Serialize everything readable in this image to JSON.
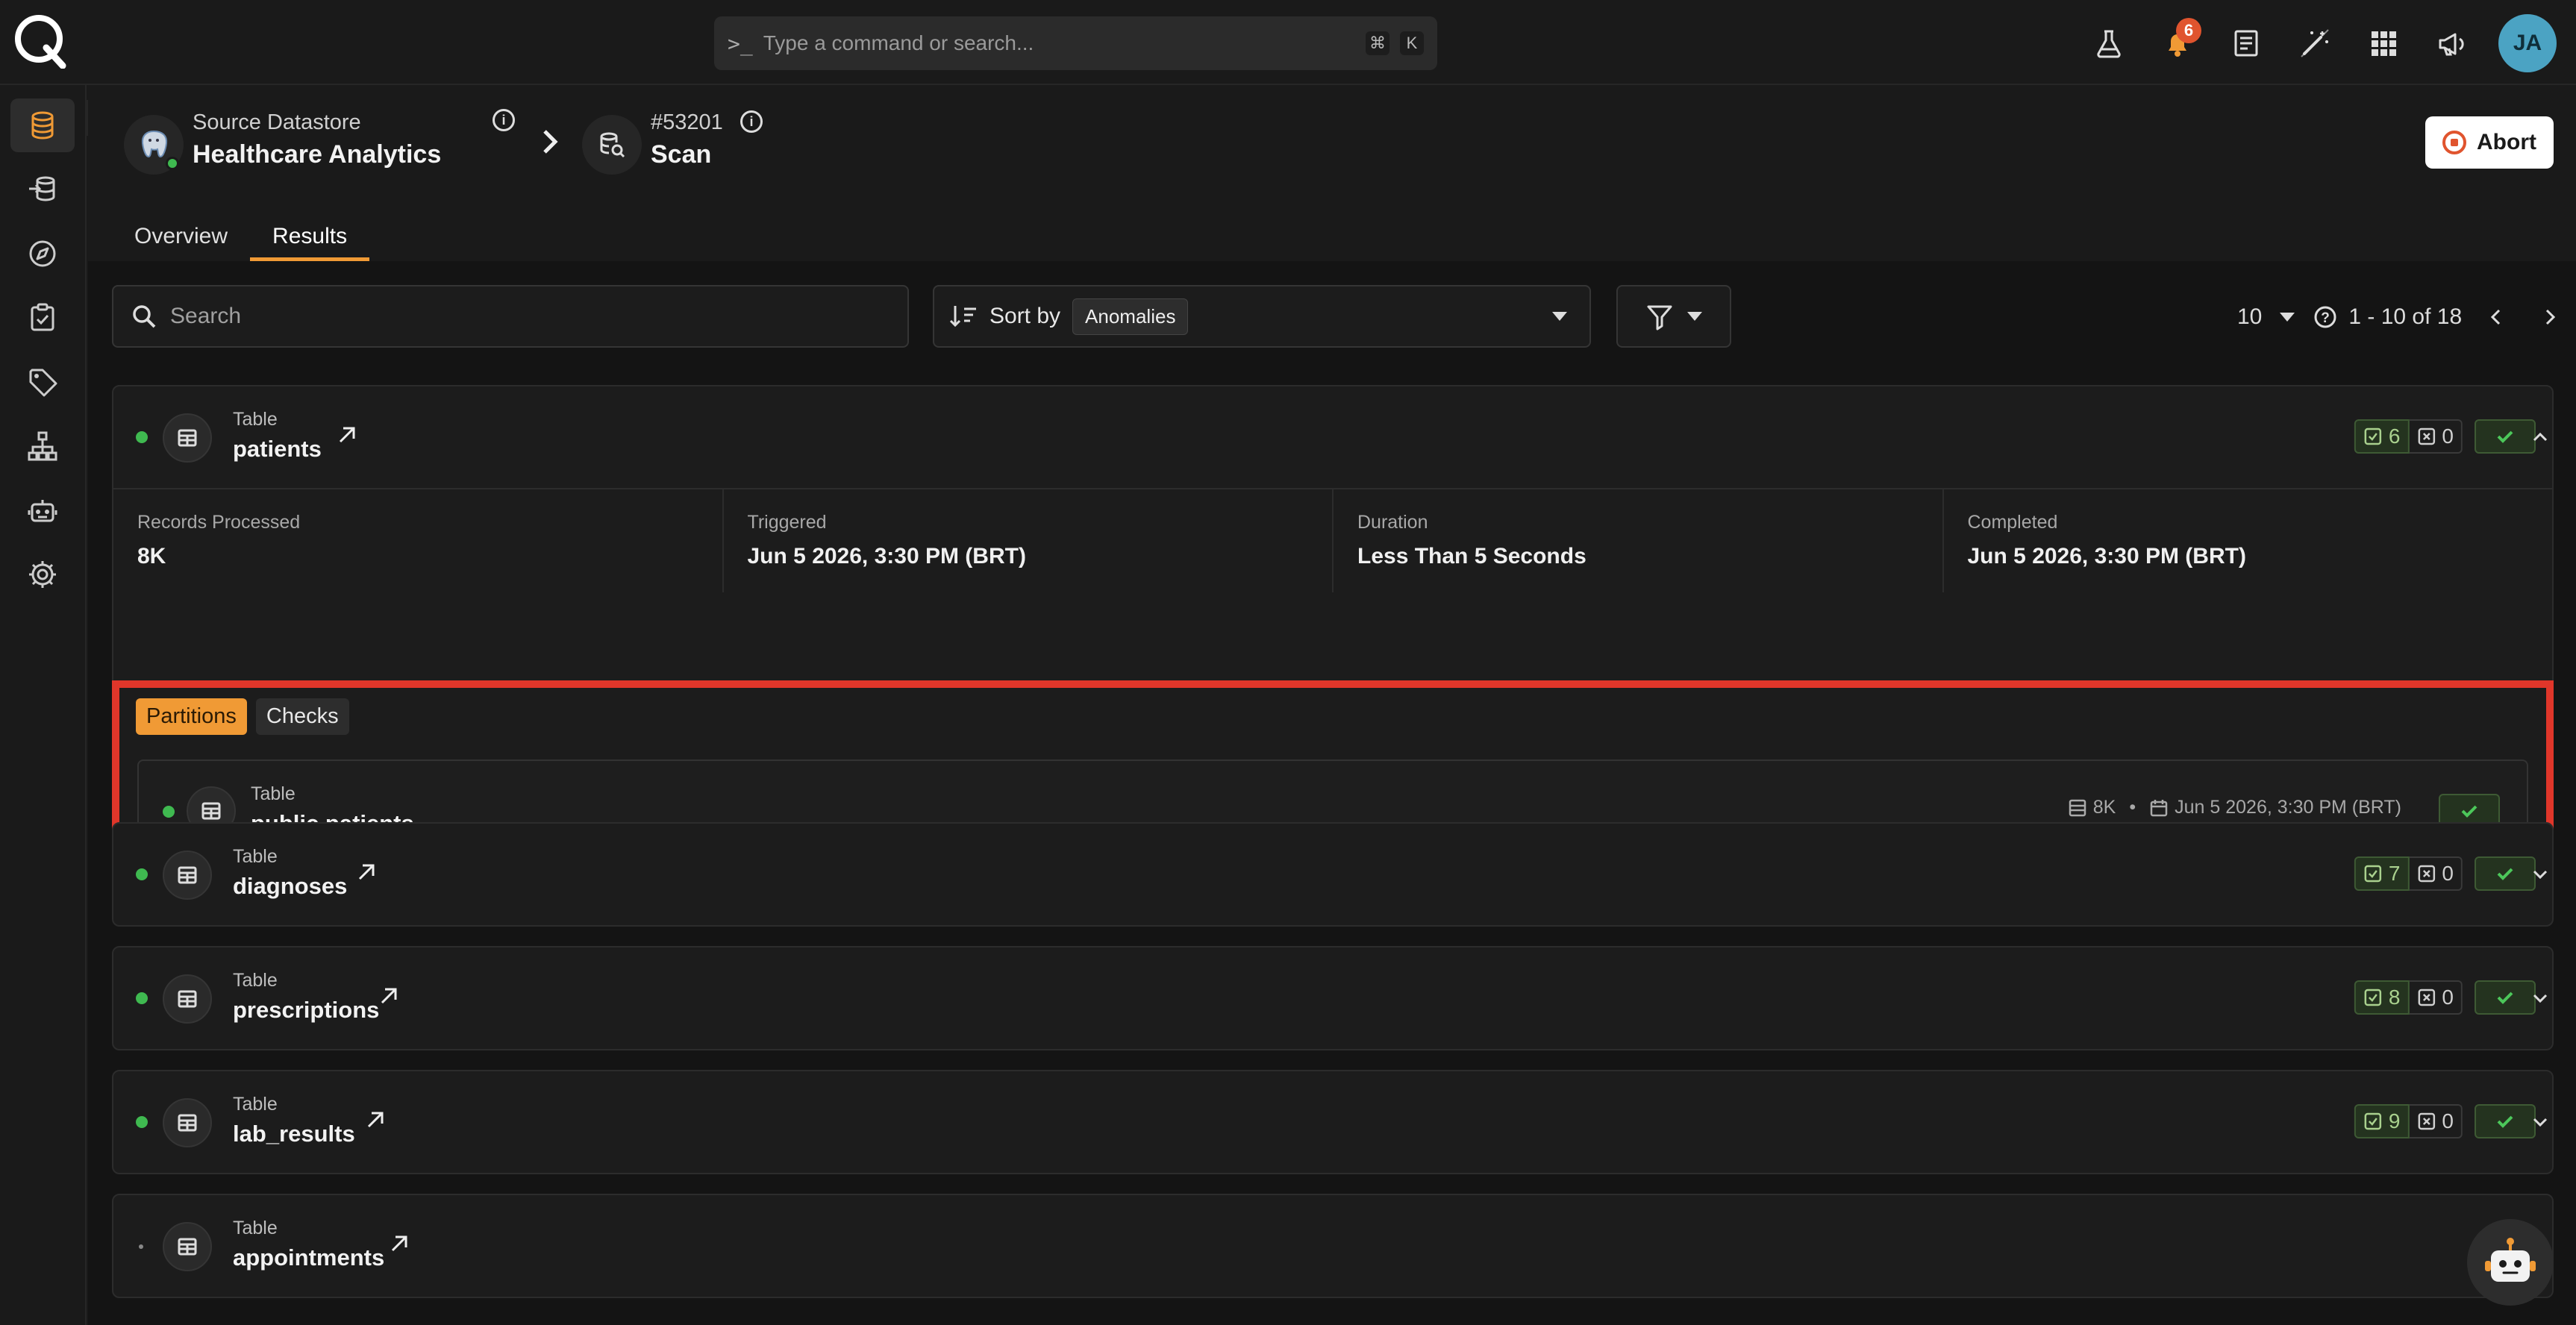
{
  "topbar": {
    "search_placeholder": "Type a command or search...",
    "shortcut_keys": [
      "⌘",
      "K"
    ],
    "icons": [
      "flask-icon",
      "bell-icon",
      "document-icon",
      "magic-wand-icon",
      "apps-grid-icon",
      "megaphone-icon"
    ],
    "notification_count": "6",
    "avatar_initials": "JA"
  },
  "rail": {
    "items": [
      "datastore-icon",
      "flows-icon",
      "explore-icon",
      "checks-icon",
      "tags-icon",
      "hierarchy-icon",
      "robot-icon",
      "settings-icon"
    ],
    "active": "datastore-icon"
  },
  "header": {
    "source_label": "Source Datastore",
    "source_name": "Healthcare Analytics",
    "scan_id": "#53201",
    "scan_title": "Scan",
    "abort_label": "Abort",
    "tabs": [
      "Overview",
      "Results"
    ],
    "active_tab": "Results"
  },
  "toolbar": {
    "search_placeholder": "Search",
    "sort_label": "Sort by",
    "sort_value": "Anomalies",
    "page_size": "10",
    "page_range": "1 - 10 of 18"
  },
  "tables": [
    {
      "type": "Table",
      "name": "patients",
      "passed": "6",
      "failed": "0",
      "expanded": true,
      "stats": [
        {
          "label": "Records Processed",
          "value": "8K"
        },
        {
          "label": "Triggered",
          "value": "Jun 5 2026, 3:30 PM (BRT)"
        },
        {
          "label": "Duration",
          "value": "Less Than 5 Seconds"
        },
        {
          "label": "Completed",
          "value": "Jun 5 2026, 3:30 PM (BRT)"
        }
      ],
      "subtabs": [
        "Partitions",
        "Checks"
      ],
      "active_subtab": "Partitions",
      "partition": {
        "type": "Table",
        "name": "public.patients",
        "records": "8K",
        "separator": "•",
        "timestamp": "Jun 5 2026, 3:30 PM (BRT)"
      }
    },
    {
      "type": "Table",
      "name": "diagnoses",
      "passed": "7",
      "failed": "0"
    },
    {
      "type": "Table",
      "name": "prescriptions",
      "passed": "8",
      "failed": "0"
    },
    {
      "type": "Table",
      "name": "lab_results",
      "passed": "9",
      "failed": "0"
    },
    {
      "type": "Table",
      "name": "appointments"
    }
  ],
  "colors": {
    "accent": "#f09a35",
    "success": "#3fb950",
    "highlight": "#e0362a",
    "avatar": "#4ba3c3"
  }
}
